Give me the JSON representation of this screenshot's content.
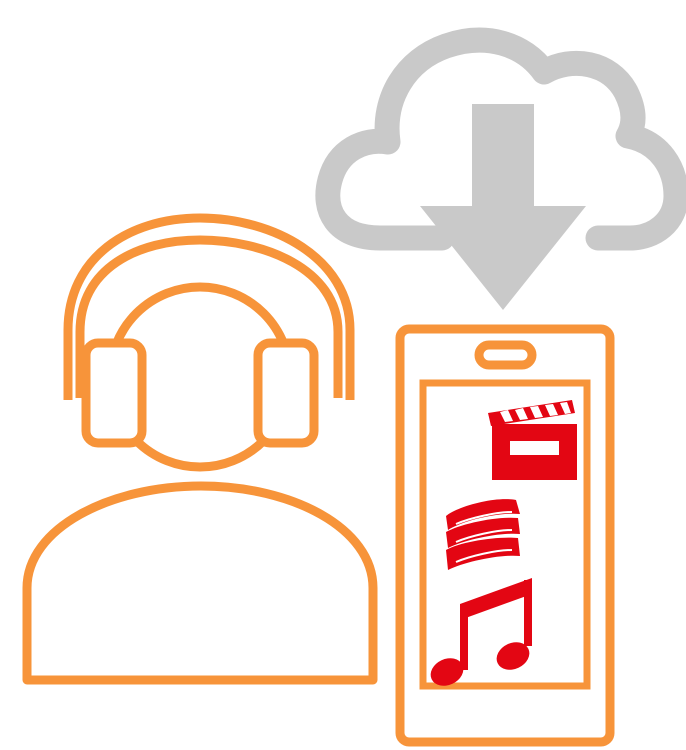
{
  "colors": {
    "cloud": "#c9c9c9",
    "person": "#f7943a",
    "phone": "#f7943a",
    "media": "#e30613"
  },
  "icons": {
    "cloud": "cloud-download-icon",
    "person": "person-with-headphones-icon",
    "phone": "smartphone-icon",
    "film": "film-clapper-icon",
    "books": "books-stack-icon",
    "music": "music-note-icon"
  }
}
